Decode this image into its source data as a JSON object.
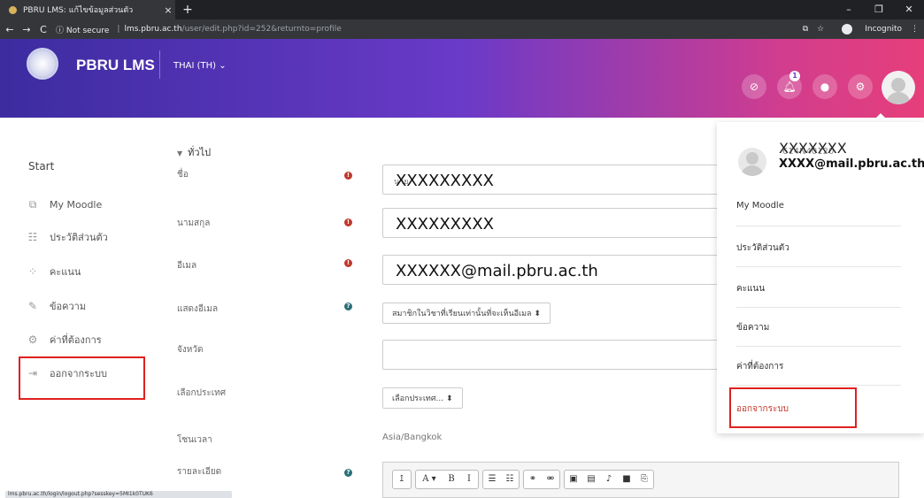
{
  "browser": {
    "tab_title": "PBRU LMS: แก้ไขข้อมูลส่วนตัว",
    "tab_close": "×",
    "new_tab": "+",
    "win_min": "–",
    "win_max": "❐",
    "win_close": "✕",
    "back": "←",
    "forward": "→",
    "reload": "C",
    "not_secure": "ⓘ Not secure",
    "host": "lms.pbru.ac.th",
    "path": "/user/edit.php?id=252&returnto=profile",
    "incognito": "Incognito",
    "translate": "⧉",
    "star": "☆",
    "menu": "⋮",
    "status_url": "lms.pbru.ac.th/login/logout.php?sesskey=5MI1k0TUK6"
  },
  "header": {
    "site_name": "PBRU LMS",
    "language": "THAI (TH) ⌄",
    "bell_count": "1"
  },
  "sidebar": {
    "start": "Start",
    "items": [
      {
        "label": "My Moodle",
        "icon": "⧉"
      },
      {
        "label": "ประวัติส่วนตัว",
        "icon": "☷"
      },
      {
        "label": "คะแนน",
        "icon": "⁘"
      },
      {
        "label": "ข้อความ",
        "icon": "✎"
      },
      {
        "label": "ค่าที่ต้องการ",
        "icon": "⚙"
      },
      {
        "label": "ออกจากระบบ",
        "icon": "⇥"
      }
    ]
  },
  "form": {
    "section": "ทั่วไป",
    "section_arrow": "▼",
    "firstname_label": "ชื่อ",
    "firstname_prefix": "นาย",
    "firstname_value": "XXXXXXXXX",
    "lastname_label": "นามสกุล",
    "lastname_value": "XXXXXXXXX",
    "email_label": "อีเมล",
    "email_value": "XXXXXX@mail.pbru.ac.th",
    "maildisplay_label": "แสดงอีเมล",
    "maildisplay_value": "สมาชิกในวิชาที่เรียนเท่านั้นที่จะเห็นอีเมล ⬍",
    "city_label": "จังหวัด",
    "country_label": "เลือกประเทศ",
    "country_value": "เลือกประเทศ... ⬍",
    "timezone_label": "โซนเวลา",
    "timezone_value": "Asia/Bangkok",
    "description_label": "รายละเอียด",
    "req_mark": "!",
    "help_mark": "?"
  },
  "editor_toolbar": {
    "g1": [
      "↥"
    ],
    "g2": [
      "A ▾",
      "B",
      "I"
    ],
    "g3": [
      "☰",
      "☷"
    ],
    "g4": [
      "⚭",
      "⚮"
    ],
    "g5": [
      "▣",
      "▤",
      "♪",
      "■",
      "⎘"
    ]
  },
  "user_menu": {
    "name": "XXXXXXX",
    "code": "614N40120",
    "email": "XXXX@mail.pbru.ac.th",
    "items": [
      "My Moodle",
      "ประวัติส่วนตัว",
      "คะแนน",
      "ข้อความ",
      "ค่าที่ต้องการ",
      "ออกจากระบบ"
    ]
  },
  "colors": {
    "header_start": "#3c2ca0",
    "header_end": "#e63f7a",
    "highlight": "#e02020",
    "logout_text": "#c0392b"
  }
}
